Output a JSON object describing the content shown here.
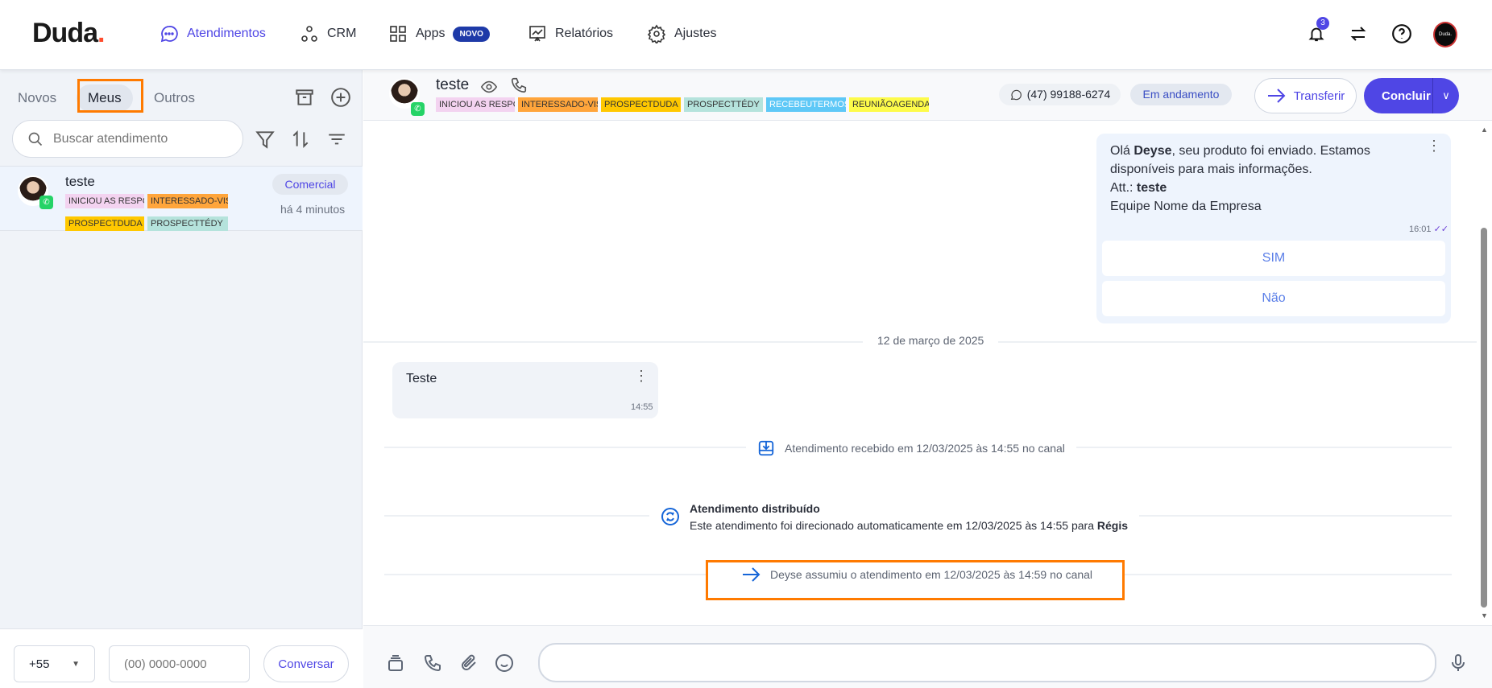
{
  "header": {
    "logo": "Duda",
    "nav": [
      {
        "label": "Atendimentos",
        "icon": "chat-bubble-icon",
        "active": true
      },
      {
        "label": "CRM",
        "icon": "crm-nodes-icon"
      },
      {
        "label": "Apps",
        "icon": "apps-grid-icon",
        "badge": "NOVO"
      },
      {
        "label": "Relatórios",
        "icon": "report-chart-icon"
      },
      {
        "label": "Ajustes",
        "icon": "gear-icon"
      }
    ],
    "notifications": "3",
    "avatar_text": "Duda."
  },
  "sidebar": {
    "tabs": [
      "Novos",
      "Meus",
      "Outros"
    ],
    "search_placeholder": "Buscar atendimento",
    "item": {
      "name": "teste",
      "tags": [
        "INICIOU AS RESPOSTAS",
        "INTERESSADO-VISITA",
        "PROSPECTDUDA",
        "PROSPECTTÉDY"
      ],
      "department": "Comercial",
      "time": "há 4 minutos"
    },
    "footer": {
      "country_code": "+55",
      "phone_placeholder": "(00) 0000-0000",
      "button": "Conversar"
    }
  },
  "chat": {
    "contact": "teste",
    "tags": [
      "INICIOU AS RESPOSTAS",
      "INTERESSADO-VISITA",
      "PROSPECTDUDA",
      "PROSPECTTÉDY",
      "RECEBEUTERMOS",
      "REUNIÃOAGENDADA"
    ],
    "phone": "(47) 99188-6274",
    "status": "Em andamento",
    "transfer": "Transferir",
    "conclude": "Concluir",
    "outgoing": {
      "greeting": "Olá ",
      "name": "Deyse",
      "line1_rest": ", seu produto foi enviado. Estamos",
      "line2": "disponíveis para mais informações.",
      "att": "Att.: ",
      "att_name": "teste",
      "line4": "Equipe Nome da Empresa",
      "time": "16:01",
      "options": [
        "SIM",
        "Não"
      ]
    },
    "date_divider": "12 de março de 2025",
    "incoming": {
      "text": "Teste",
      "time": "14:55"
    },
    "events": {
      "received": "Atendimento recebido em 12/03/2025 às 14:55 no canal",
      "distributed_title": "Atendimento distribuído",
      "distributed_text": "Este atendimento foi direcionado automaticamente em 12/03/2025 às 14:55 para ",
      "distributed_to": "Régis",
      "assumed": "Deyse assumiu o atendimento em 12/03/2025 às 14:59 no canal"
    },
    "input_value": ""
  },
  "colors": {
    "accent": "#4f46e5",
    "highlight": "#ff7a00",
    "tag_pink": "#f3d3f0",
    "tag_orange": "#ffa53b",
    "tag_yellow": "#ffc800",
    "tag_teal": "#b5e3dc",
    "tag_blue": "#5ec8f7",
    "tag_lemon": "#fdfb4a"
  }
}
